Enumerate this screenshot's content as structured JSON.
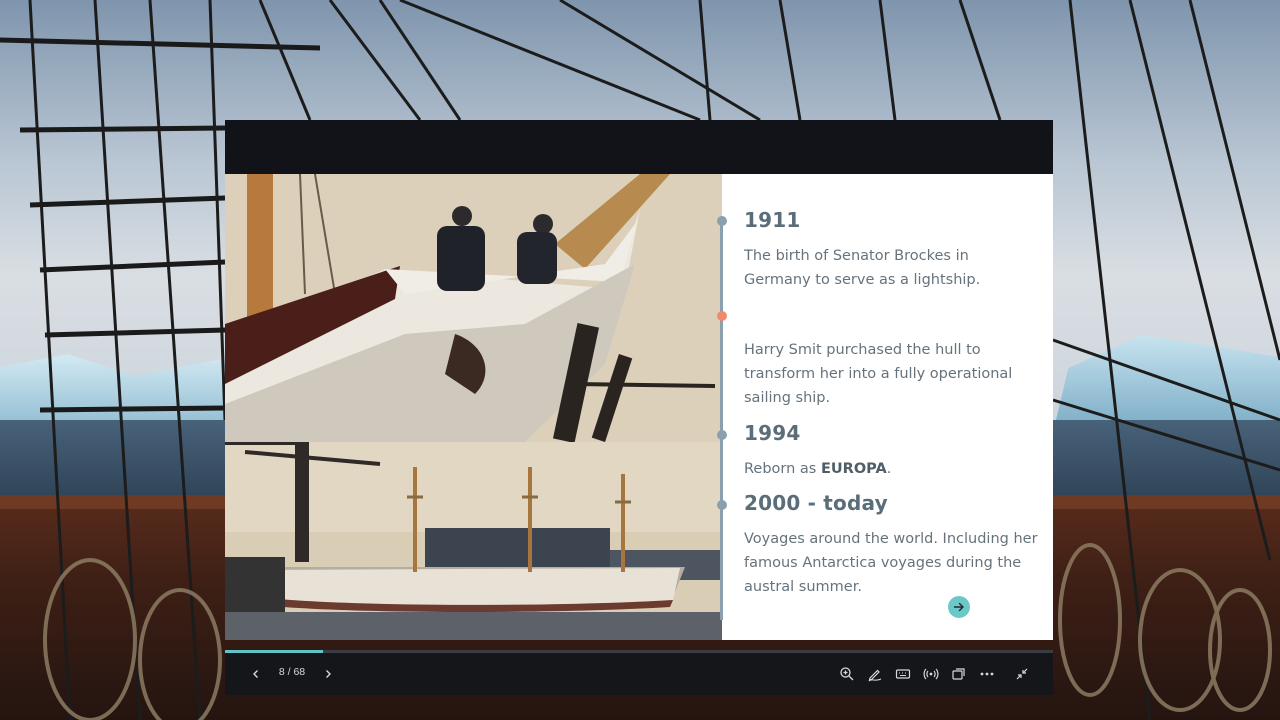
{
  "slide": {
    "timeline": [
      {
        "year": "1911",
        "desc": "The birth of Senator Brockes in\n Germany to serve as a lightship."
      },
      {
        "year": "",
        "desc": "Harry Smit purchased the hull to transform her into a fully operational sailing ship."
      },
      {
        "year": "1994",
        "desc_prefix": "Reborn as ",
        "desc_bold": "EUROPA",
        "desc_suffix": "."
      },
      {
        "year": "2000 - today",
        "desc": "Voyages around the world. Including her famous Antarctica voyages during the austral summer."
      }
    ],
    "accent_color": "#f08a6c",
    "timeline_color": "#8aa0ae",
    "next_button_color": "#6cc8c8"
  },
  "player": {
    "current_page": 8,
    "total_pages": 68,
    "page_indicator": "8 / 68",
    "progress_fraction": 0.118,
    "icons": [
      "chevron-left-icon",
      "chevron-right-icon",
      "zoom-icon",
      "pen-icon",
      "keyboard-icon",
      "broadcast-icon",
      "windows-icon",
      "more-icon",
      "collapse-icon"
    ]
  }
}
